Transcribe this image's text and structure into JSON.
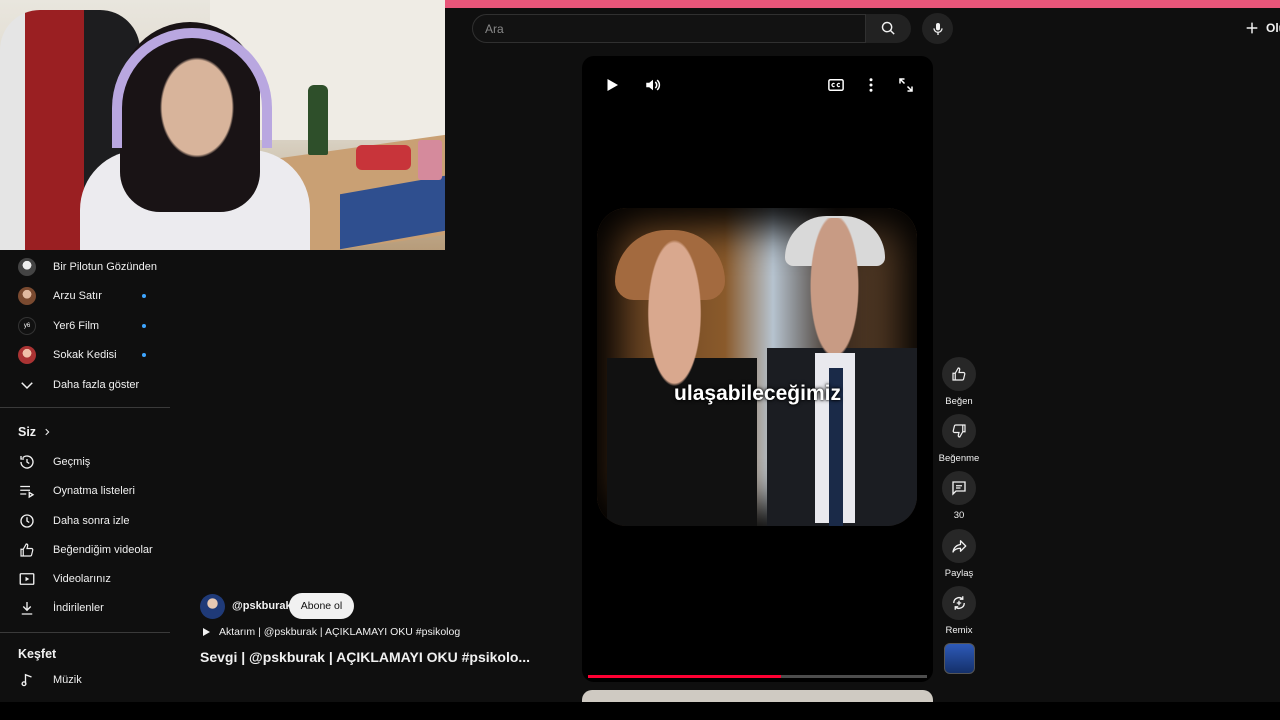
{
  "search": {
    "placeholder": "Ara"
  },
  "header": {
    "create_label": "Olu"
  },
  "sidebar": {
    "subscriptions": [
      {
        "label": "Bir Pilotun Gözünden",
        "icon": "channel-avatar",
        "new": false
      },
      {
        "label": "Arzu Satır",
        "icon": "channel-avatar",
        "new": true
      },
      {
        "label": "Yer6 Film",
        "icon": "channel-avatar",
        "new": true
      },
      {
        "label": "Sokak Kedisi",
        "icon": "channel-avatar",
        "new": true
      }
    ],
    "show_more": "Daha fazla göster",
    "you_heading": "Siz",
    "you_items": [
      {
        "label": "Geçmiş",
        "icon": "history-icon"
      },
      {
        "label": "Oynatma listeleri",
        "icon": "playlists-icon"
      },
      {
        "label": "Daha sonra izle",
        "icon": "watch-later-icon"
      },
      {
        "label": "Beğendiğim videolar",
        "icon": "liked-icon"
      },
      {
        "label": "Videolarınız",
        "icon": "your-videos-icon"
      },
      {
        "label": "İndirilenler",
        "icon": "downloads-icon"
      }
    ],
    "explore_heading": "Keşfet",
    "explore_items": [
      {
        "label": "Müzik",
        "icon": "music-icon"
      }
    ]
  },
  "player": {
    "caption": "ulaşabileceğimiz",
    "progress_fraction": 0.57
  },
  "actions": {
    "like": "Beğen",
    "dislike": "Beğenme",
    "comments": "30",
    "share": "Paylaş",
    "remix": "Remix"
  },
  "channel": {
    "name": "@pskburak",
    "subscribe": "Abone ol"
  },
  "video": {
    "audio": "Aktarım | @pskburak | AÇIKLAMAYI OKU  #psikolog",
    "title": "Sevgi | @pskburak | AÇIKLAMAYI OKU  #psikolo..."
  },
  "colors": {
    "accent": "#ff0033",
    "link_dot": "#3ea6ff",
    "background": "#0f0f0f"
  }
}
